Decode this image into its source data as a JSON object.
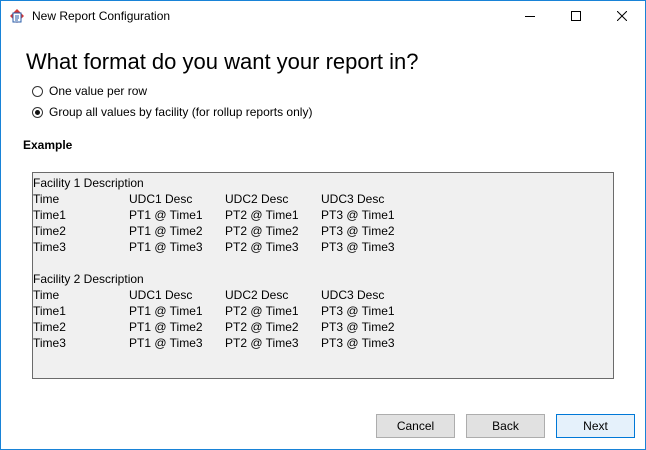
{
  "window": {
    "title": "New Report Configuration"
  },
  "heading": "What format do you want your report in?",
  "options": [
    {
      "label": "One value per row",
      "checked": false
    },
    {
      "label": "Group all values by facility (for rollup reports only)",
      "checked": true
    }
  ],
  "example": {
    "label": "Example",
    "facilities": [
      {
        "title": "Facility 1 Description",
        "header": [
          "Time",
          "UDC1 Desc",
          "UDC2 Desc",
          "UDC3 Desc"
        ],
        "rows": [
          [
            "Time1",
            "PT1 @ Time1",
            "PT2 @ Time1",
            "PT3 @ Time1"
          ],
          [
            "Time2",
            "PT1 @ Time2",
            "PT2 @ Time2",
            "PT3 @ Time2"
          ],
          [
            "Time3",
            "PT1 @ Time3",
            "PT2 @ Time3",
            "PT3 @ Time3"
          ]
        ]
      },
      {
        "title": "Facility 2 Description",
        "header": [
          "Time",
          "UDC1 Desc",
          "UDC2 Desc",
          "UDC3 Desc"
        ],
        "rows": [
          [
            "Time1",
            "PT1 @ Time1",
            "PT2 @ Time1",
            "PT3 @ Time1"
          ],
          [
            "Time2",
            "PT1 @ Time2",
            "PT2 @ Time2",
            "PT3 @ Time2"
          ],
          [
            "Time3",
            "PT1 @ Time3",
            "PT2 @ Time3",
            "PT3 @ Time3"
          ]
        ]
      }
    ]
  },
  "buttons": {
    "cancel": "Cancel",
    "back": "Back",
    "next": "Next"
  },
  "icons": {
    "app": "report-app-icon",
    "minimize": "minimize-icon",
    "maximize": "maximize-icon",
    "close": "close-icon"
  },
  "colors": {
    "window_border": "#1883d7",
    "default_button_border": "#0078d7",
    "default_button_bg": "#e5f1fb"
  }
}
